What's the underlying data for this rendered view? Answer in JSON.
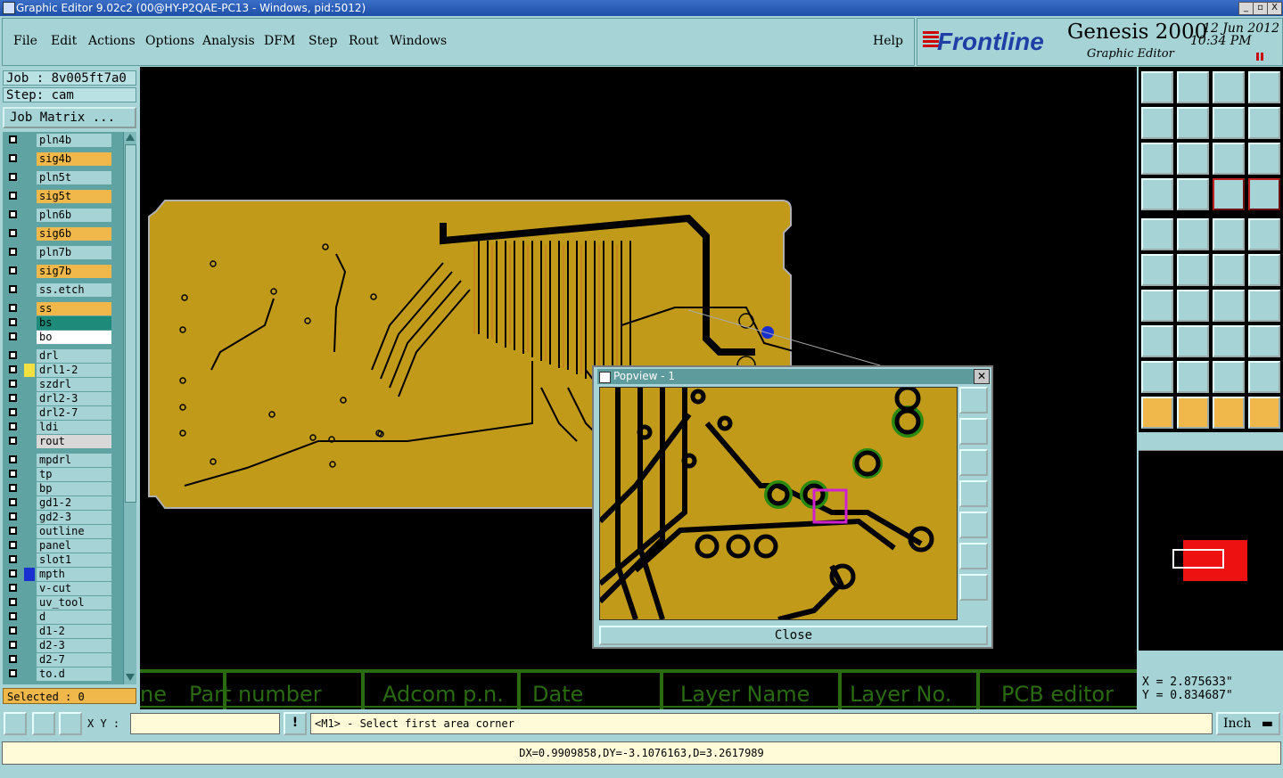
{
  "window": {
    "title": "Graphic Editor 9.02c2 (00@HY-P2QAE-PC13 - Windows, pid:5012)",
    "controls": [
      "_",
      "▫",
      "X"
    ]
  },
  "menu": {
    "items": [
      "File",
      "Edit",
      "Actions",
      "Options",
      "Analysis",
      "DFM",
      "Step",
      "Rout",
      "Windows"
    ],
    "help": "Help"
  },
  "brand": {
    "logo": "Frontline",
    "product": "Genesis 2000",
    "subtitle": "Graphic Editor",
    "date": "12 Jun 2012",
    "time": "10:34 PM"
  },
  "job": {
    "job_label": "Job : 8v005ft7a0",
    "step_label": "Step: cam",
    "matrix_button": "Job Matrix ..."
  },
  "layers": [
    {
      "name": "pln4b",
      "color": "#a6d4d6"
    },
    {
      "name": "sig4b",
      "color": "#f0b84a"
    },
    {
      "name": "pln5t",
      "color": "#a6d4d6"
    },
    {
      "name": "sig5t",
      "color": "#f0b84a"
    },
    {
      "name": "pln6b",
      "color": "#a6d4d6"
    },
    {
      "name": "sig6b",
      "color": "#f0b84a"
    },
    {
      "name": "pln7b",
      "color": "#a6d4d6"
    },
    {
      "name": "sig7b",
      "color": "#f0b84a"
    },
    {
      "name": "ss.etch",
      "color": "#a6d4d6"
    },
    {
      "name": "ss",
      "color": "#f0b84a"
    },
    {
      "name": "bs",
      "color": "#1e8a7a"
    },
    {
      "name": "bo",
      "color": "#ffffff"
    },
    {
      "name": "drl",
      "color": "#a6d4d6"
    },
    {
      "name": "drl1-2",
      "color": "#a6d4d6",
      "swatch": "#f0e040"
    },
    {
      "name": "szdrl",
      "color": "#a6d4d6"
    },
    {
      "name": "drl2-3",
      "color": "#a6d4d6"
    },
    {
      "name": "drl2-7",
      "color": "#a6d4d6"
    },
    {
      "name": "ldi",
      "color": "#a6d4d6"
    },
    {
      "name": "rout",
      "color": "#d8d8d8"
    },
    {
      "name": "mpdrl",
      "color": "#a6d4d6"
    },
    {
      "name": "tp",
      "color": "#a6d4d6"
    },
    {
      "name": "bp",
      "color": "#a6d4d6"
    },
    {
      "name": "gd1-2",
      "color": "#a6d4d6"
    },
    {
      "name": "gd2-3",
      "color": "#a6d4d6"
    },
    {
      "name": "outline",
      "color": "#a6d4d6"
    },
    {
      "name": "panel",
      "color": "#a6d4d6"
    },
    {
      "name": "slot1",
      "color": "#a6d4d6"
    },
    {
      "name": "mpth",
      "color": "#a6d4d6",
      "swatch": "#1a2fd0"
    },
    {
      "name": "v-cut",
      "color": "#a6d4d6"
    },
    {
      "name": "uv_tool",
      "color": "#a6d4d6"
    },
    {
      "name": "d",
      "color": "#a6d4d6"
    },
    {
      "name": "d1-2",
      "color": "#a6d4d6"
    },
    {
      "name": "d2-3",
      "color": "#a6d4d6"
    },
    {
      "name": "d2-7",
      "color": "#a6d4d6"
    },
    {
      "name": "to.d",
      "color": "#a6d4d6"
    }
  ],
  "selected_label": "Selected : 0",
  "titleblock": [
    "ne",
    "Part number",
    "Adcom p.n.",
    "Date",
    "Layer Name",
    "Layer No.",
    "PCB editor"
  ],
  "popview": {
    "title": "Popview - 1",
    "close_label": "Close"
  },
  "coords": {
    "x": "X = 2.875633\"",
    "y": "Y = 0.834687\""
  },
  "command": {
    "xy_label": "X Y :",
    "xy_value": "",
    "prompt": "<M1> - Select first area corner",
    "unit": "Inch"
  },
  "status_line": "DX=0.9909858,DY=-3.1076163,D=3.2617989",
  "colors": {
    "copper": "#c19a1a",
    "trace": "#000000",
    "background": "#a6d4d6",
    "highlight": "#f0b84a"
  }
}
